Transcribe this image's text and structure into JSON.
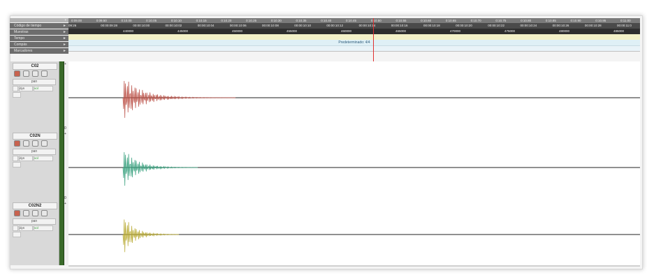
{
  "ruler": {
    "labels": [
      "Código de tiempo",
      "Muestras",
      "Tempo",
      "Compás",
      "Marcadores"
    ],
    "minutes": [
      "0:09.00",
      "0:09.50",
      "0:10.00",
      "0:10.05",
      "0:10.10",
      "0:10.15",
      "0:10.20",
      "0:10.25",
      "0:10.30",
      "0:10.35",
      "0:10.40",
      "0:10.45",
      "0:10.50",
      "0:10.55",
      "0:10.60",
      "0:10.65",
      "0:10.70",
      "0:10.75",
      "0:10.80",
      "0:10.85",
      "0:10.90",
      "0:10.95",
      "0:11.00"
    ],
    "timecodes": [
      "09:26",
      "00:00:09:28",
      "00:00:10:00",
      "00:00:10:02",
      "00:00:10:04",
      "00:00:10:06",
      "00:00:10:08",
      "00:00:10:10",
      "00:00:10:12",
      "00:00:10:14",
      "00:00:10:16",
      "00:00:10:18",
      "00:00:10:20",
      "00:00:10:22",
      "00:00:10:24",
      "00:00:10:26",
      "00:00:10:28",
      "00:00:11:0"
    ],
    "samples": [
      "440000",
      "445000",
      "450000",
      "455000",
      "460000",
      "465000",
      "470000",
      "475000",
      "480000",
      "485000"
    ],
    "meter": "Predeterminado: 4/4"
  },
  "tracks": [
    {
      "name": "C02",
      "pan": "pan",
      "dyn": "dyn",
      "vol": "vol",
      "color": "#e8857c",
      "stroke": "#b84a40"
    },
    {
      "name": "C02N",
      "pan": "pan",
      "dyn": "dyn",
      "vol": "vol",
      "color": "#7fd6b8",
      "stroke": "#2f9c78"
    },
    {
      "name": "C02N2",
      "pan": "pan",
      "dyn": "dyn",
      "vol": "vol",
      "color": "#f0e67a",
      "stroke": "#b5a62a"
    }
  ],
  "colors": {
    "playhead": "#e03030",
    "meter": "#3a6a2a"
  }
}
